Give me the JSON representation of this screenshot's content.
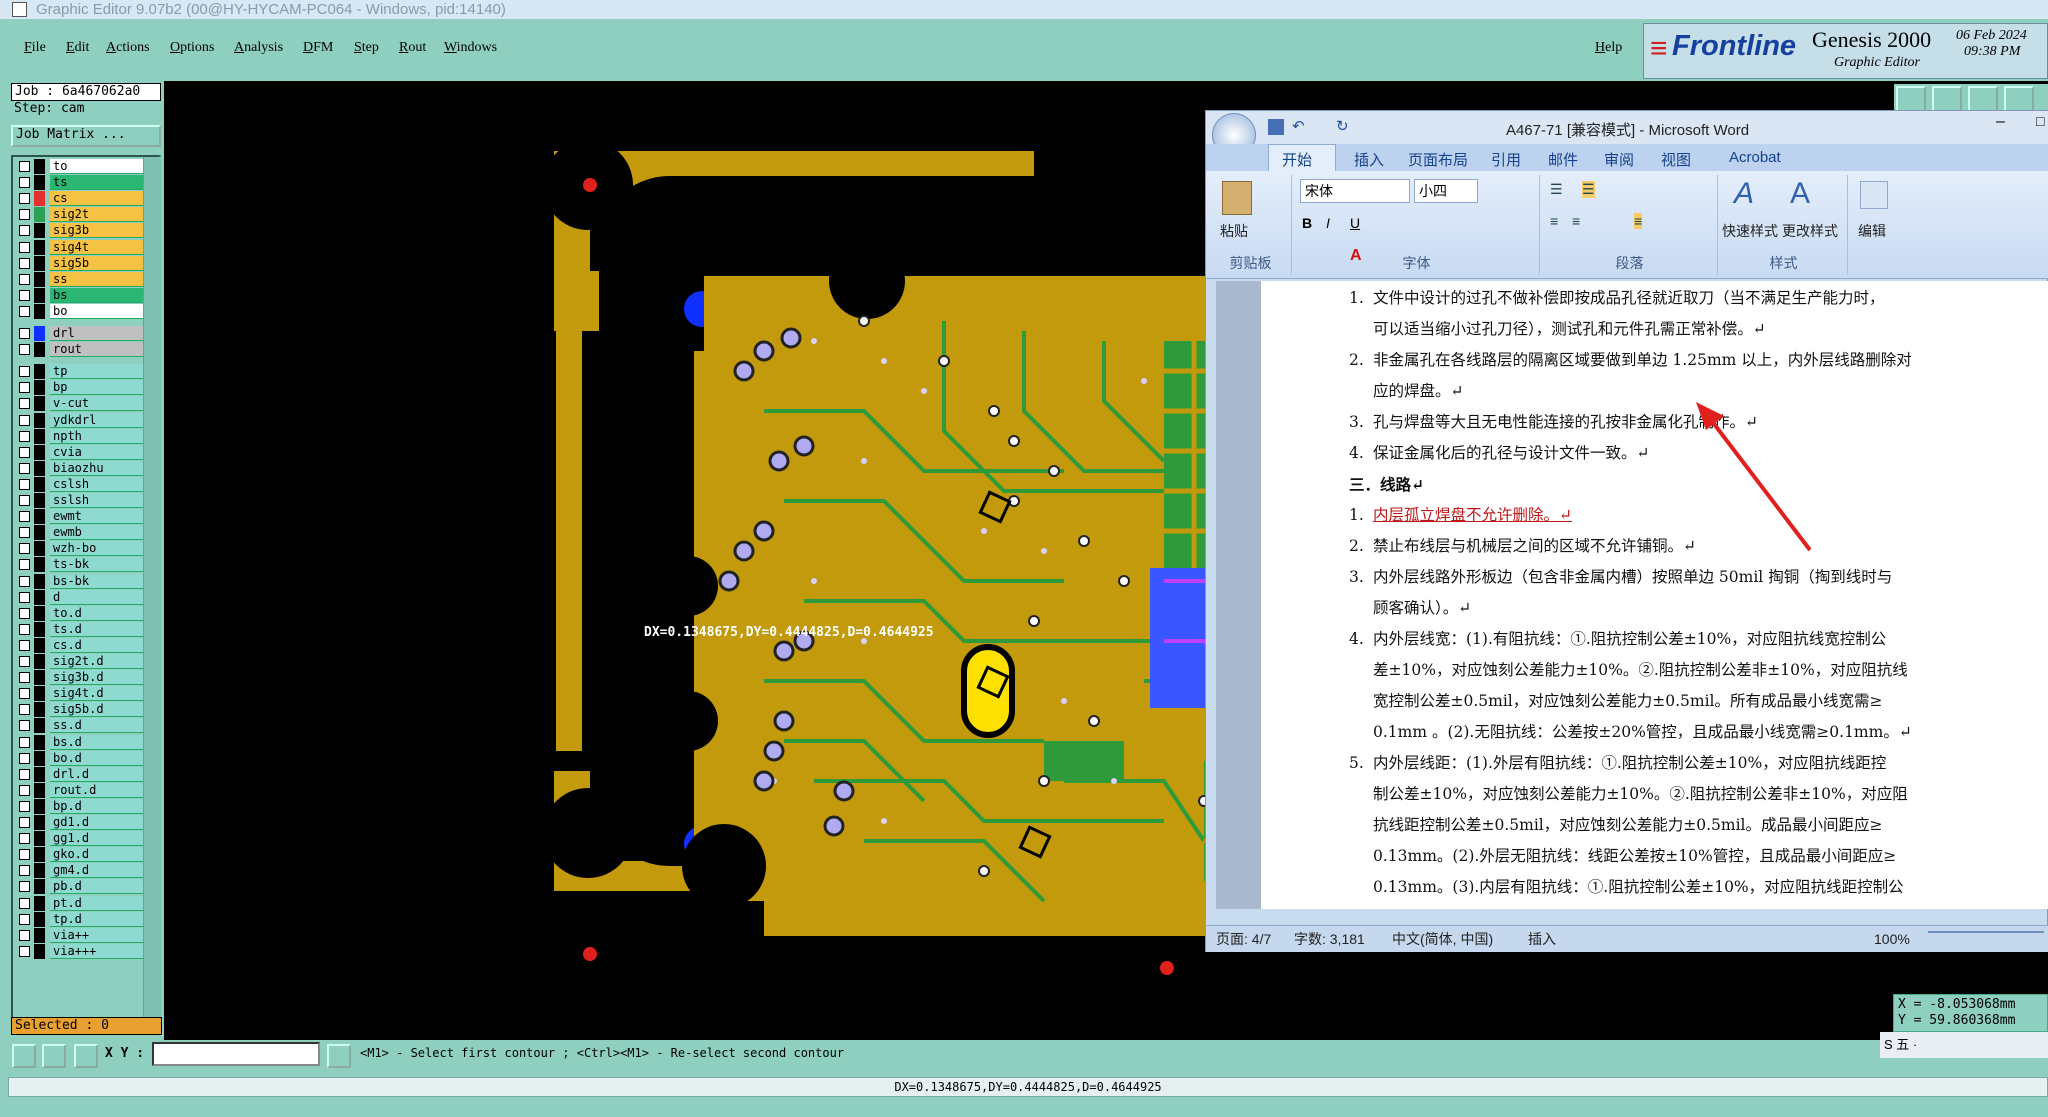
{
  "genesis": {
    "title": "Graphic Editor 9.07b2 (00@HY-HYCAM-PC064 - Windows, pid:14140)",
    "menu": [
      "File",
      "Edit",
      "Actions",
      "Options",
      "Analysis",
      "DFM",
      "Step",
      "Rout",
      "Windows"
    ],
    "help": "Help",
    "logo": {
      "brand": "Frontline",
      "product": "Genesis 2000",
      "subtitle": "Graphic Editor",
      "date": "06 Feb 2024",
      "time": "09:38 PM"
    },
    "job": "Job : 6a467062a0",
    "step": "Step: cam",
    "job_matrix": "Job Matrix ...",
    "layers": [
      {
        "name": "to",
        "color": "#ffffff",
        "swatch": "#000"
      },
      {
        "name": "ts",
        "color": "#2bb673",
        "swatch": "#000"
      },
      {
        "name": "cs",
        "color": "#f6c243",
        "swatch": "#e53030"
      },
      {
        "name": "sig2t",
        "color": "#f6c243",
        "swatch": "#2aa055"
      },
      {
        "name": "sig3b",
        "color": "#f6c243",
        "swatch": "#000"
      },
      {
        "name": "sig4t",
        "color": "#f6c243",
        "swatch": "#000"
      },
      {
        "name": "sig5b",
        "color": "#f6c243",
        "swatch": "#000"
      },
      {
        "name": "ss",
        "color": "#f6c243",
        "swatch": "#000"
      },
      {
        "name": "bs",
        "color": "#2bb673",
        "swatch": "#000"
      },
      {
        "name": "bo",
        "color": "#ffffff",
        "swatch": "#000"
      },
      {
        "name": "drl",
        "color": "#c0c0c0",
        "swatch": "#1030ff"
      },
      {
        "name": "rout",
        "color": "#c0c0c0",
        "swatch": "#000"
      },
      {
        "name": "tp",
        "color": "#8ed9d0",
        "swatch": "#000"
      },
      {
        "name": "bp",
        "color": "#8ed9d0",
        "swatch": "#000"
      },
      {
        "name": "v-cut",
        "color": "#8ed9d0",
        "swatch": "#000"
      },
      {
        "name": "ydkdrl",
        "color": "#8ed9d0",
        "swatch": "#000"
      },
      {
        "name": "npth",
        "color": "#8ed9d0",
        "swatch": "#000"
      },
      {
        "name": "cvia",
        "color": "#8ed9d0",
        "swatch": "#000"
      },
      {
        "name": "biaozhu",
        "color": "#8ed9d0",
        "swatch": "#000"
      },
      {
        "name": "cslsh",
        "color": "#8ed9d0",
        "swatch": "#000"
      },
      {
        "name": "sslsh",
        "color": "#8ed9d0",
        "swatch": "#000"
      },
      {
        "name": "ewmt",
        "color": "#8ed9d0",
        "swatch": "#000"
      },
      {
        "name": "ewmb",
        "color": "#8ed9d0",
        "swatch": "#000"
      },
      {
        "name": "wzh-bo",
        "color": "#8ed9d0",
        "swatch": "#000"
      },
      {
        "name": "ts-bk",
        "color": "#8ed9d0",
        "swatch": "#000"
      },
      {
        "name": "bs-bk",
        "color": "#8ed9d0",
        "swatch": "#000"
      },
      {
        "name": "d",
        "color": "#8ed9d0",
        "swatch": "#000"
      },
      {
        "name": "to.d",
        "color": "#8ed9d0",
        "swatch": "#000"
      },
      {
        "name": "ts.d",
        "color": "#8ed9d0",
        "swatch": "#000"
      },
      {
        "name": "cs.d",
        "color": "#8ed9d0",
        "swatch": "#000"
      },
      {
        "name": "sig2t.d",
        "color": "#8ed9d0",
        "swatch": "#000"
      },
      {
        "name": "sig3b.d",
        "color": "#8ed9d0",
        "swatch": "#000"
      },
      {
        "name": "sig4t.d",
        "color": "#8ed9d0",
        "swatch": "#000"
      },
      {
        "name": "sig5b.d",
        "color": "#8ed9d0",
        "swatch": "#000"
      },
      {
        "name": "ss.d",
        "color": "#8ed9d0",
        "swatch": "#000"
      },
      {
        "name": "bs.d",
        "color": "#8ed9d0",
        "swatch": "#000"
      },
      {
        "name": "bo.d",
        "color": "#8ed9d0",
        "swatch": "#000"
      },
      {
        "name": "drl.d",
        "color": "#8ed9d0",
        "swatch": "#000"
      },
      {
        "name": "rout.d",
        "color": "#8ed9d0",
        "swatch": "#000"
      },
      {
        "name": "bp.d",
        "color": "#8ed9d0",
        "swatch": "#000"
      },
      {
        "name": "gd1.d",
        "color": "#8ed9d0",
        "swatch": "#000"
      },
      {
        "name": "gg1.d",
        "color": "#8ed9d0",
        "swatch": "#000"
      },
      {
        "name": "gko.d",
        "color": "#8ed9d0",
        "swatch": "#000"
      },
      {
        "name": "gm4.d",
        "color": "#8ed9d0",
        "swatch": "#000"
      },
      {
        "name": "pb.d",
        "color": "#8ed9d0",
        "swatch": "#000"
      },
      {
        "name": "pt.d",
        "color": "#8ed9d0",
        "swatch": "#000"
      },
      {
        "name": "tp.d",
        "color": "#8ed9d0",
        "swatch": "#000"
      },
      {
        "name": "via++",
        "color": "#8ed9d0",
        "swatch": "#000"
      },
      {
        "name": "via+++",
        "color": "#8ed9d0",
        "swatch": "#000"
      }
    ],
    "selected": "Selected : 0",
    "xy_label": "X Y :",
    "hint": "<M1> - Select first contour ; <Ctrl><M1> - Re-select second contour",
    "measurement": "DX=0.1348675,DY=0.4444825,D=0.4644925",
    "canvas_measure": "DX=0.1348675,DY=0.4444825,D=0.4644925",
    "coords": {
      "x": "X = -8.053068mm",
      "y": "Y = 59.860368mm"
    }
  },
  "word": {
    "title": "A467-71 [兼容模式] - Microsoft Word",
    "tabs": [
      "开始",
      "插入",
      "页面布局",
      "引用",
      "邮件",
      "审阅",
      "视图",
      "Acrobat"
    ],
    "groups": {
      "clipboard": "剪贴板",
      "font": "字体",
      "paragraph": "段落",
      "styles": "样式"
    },
    "paste": "粘贴",
    "font_name": "宋体",
    "font_size": "小四",
    "quick_styles": "快速样式",
    "change_styles": "更改样式",
    "edit": "编辑",
    "lines": [
      {
        "num": "1.",
        "text": "文件中设计的过孔不做补偿即按成品孔径就近取刀（当不满足生产能力时，"
      },
      {
        "num": "",
        "text": "可以适当缩小过孔刀径），测试孔和元件孔需正常补偿。↵"
      },
      {
        "num": "2.",
        "text": "非金属孔在各线路层的隔离区域要做到单边 1.25mm 以上，内外层线路删除对"
      },
      {
        "num": "",
        "text": "应的焊盘。↵"
      },
      {
        "num": "3.",
        "text": "孔与焊盘等大且无电性能连接的孔按非金属化孔制作。↵"
      },
      {
        "num": "4.",
        "text": "保证金属化后的孔径与设计文件一致。↵"
      },
      {
        "num": "",
        "text": "三．线路↵"
      },
      {
        "num": "1.",
        "text": "内层孤立焊盘不允许删除。↵"
      },
      {
        "num": "2.",
        "text": "禁止布线层与机械层之间的区域不允许铺铜。↵"
      },
      {
        "num": "3.",
        "text": "内外层线路外形板边（包含非金属内槽）按照单边 50mil 掏铜（掏到线时与"
      },
      {
        "num": "",
        "text": "顾客确认）。↵"
      },
      {
        "num": "4.",
        "text": "内外层线宽：(1).有阻抗线：①.阻抗控制公差±10%，对应阻抗线宽控制公"
      },
      {
        "num": "",
        "text": "差±10%，对应蚀刻公差能力±10%。②.阻抗控制公差非±10%，对应阻抗线"
      },
      {
        "num": "",
        "text": "宽控制公差±0.5mil，对应蚀刻公差能力±0.5mil。所有成品最小线宽需≥"
      },
      {
        "num": "",
        "text": "0.1mm 。(2).无阻抗线：公差按±20%管控，且成品最小线宽需≥0.1mm。↵"
      },
      {
        "num": "5.",
        "text": "内外层线距：(1).外层有阻抗线：①.阻抗控制公差±10%，对应阻抗线距控"
      },
      {
        "num": "",
        "text": "制公差±10%，对应蚀刻公差能力±10%。②.阻抗控制公差非±10%，对应阻"
      },
      {
        "num": "",
        "text": "抗线距控制公差±0.5mil，对应蚀刻公差能力±0.5mil。成品最小间距应≥"
      },
      {
        "num": "",
        "text": "0.13mm。(2).外层无阻抗线：线距公差按±10%管控，且成品最小间距应≥"
      },
      {
        "num": "",
        "text": "0.13mm。(3).内层有阻抗线：①.阻抗控制公差±10%，对应阻抗线距控制公"
      }
    ],
    "status": {
      "page": "页面: 4/7",
      "words": "字数: 3,181",
      "lang": "中文(简体, 中国)",
      "mode": "插入",
      "zoom": "100%"
    }
  },
  "colors": {
    "panel": "#8fcfc0",
    "copper": "#c29a0c",
    "green": "#2e9a3a",
    "blue": "#3a56ff",
    "red": "#e0201c"
  }
}
